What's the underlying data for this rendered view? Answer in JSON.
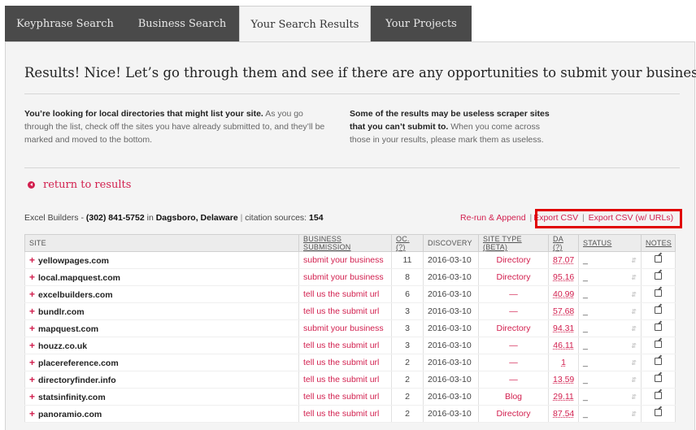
{
  "tabs": [
    {
      "label": "Keyphrase Search"
    },
    {
      "label": "Business Search"
    },
    {
      "label": "Your Search Results"
    },
    {
      "label": "Your Projects"
    }
  ],
  "headline": "Results! Nice! Let’s go through them and see if there are any opportunities to submit your business.",
  "intro_left": {
    "bold": "You’re looking for local directories that might list your site.",
    "text": " As you go through the list, check off the sites you have already submitted to, and they’ll be marked and moved to the bottom."
  },
  "intro_right": {
    "bold": "Some of the results may be useless scraper sites that you can’t submit to.",
    "text": " When you come across those in your results, please mark them as useless."
  },
  "return_label": "return to results",
  "business": {
    "name": "Excel Builders",
    "dash": " - ",
    "phone": "(302) 841-5752",
    "in": " in ",
    "location": "Dagsboro, Delaware",
    "sep": " | ",
    "citations_label": "citation sources: ",
    "citations": "154"
  },
  "actions": {
    "rerun": "Re-run & Append",
    "sep": "|",
    "export_csv": "Export CSV",
    "export_csv_urls": "Export CSV (w/ URLs)"
  },
  "table": {
    "headers": [
      "SITE",
      "BUSINESS SUBMISSION",
      "OC. (?)",
      "DISCOVERY",
      "SITE TYPE (BETA)",
      "DA (?)",
      "STATUS",
      "NOTES"
    ],
    "rows": [
      {
        "site": "yellowpages.com",
        "sub": "submit your business",
        "oc": "11",
        "disc": "2016-03-10",
        "type": "Directory",
        "da": "87.07",
        "status": "_"
      },
      {
        "site": "local.mapquest.com",
        "sub": "submit your business",
        "oc": "8",
        "disc": "2016-03-10",
        "type": "Directory",
        "da": "95.16",
        "status": "_"
      },
      {
        "site": "excelbuilders.com",
        "sub": "tell us the submit url",
        "oc": "6",
        "disc": "2016-03-10",
        "type": "—",
        "da": "40.99",
        "status": "_"
      },
      {
        "site": "bundlr.com",
        "sub": "tell us the submit url",
        "oc": "3",
        "disc": "2016-03-10",
        "type": "—",
        "da": "57.68",
        "status": "_"
      },
      {
        "site": "mapquest.com",
        "sub": "submit your business",
        "oc": "3",
        "disc": "2016-03-10",
        "type": "Directory",
        "da": "94.31",
        "status": "_"
      },
      {
        "site": "houzz.co.uk",
        "sub": "tell us the submit url",
        "oc": "3",
        "disc": "2016-03-10",
        "type": "—",
        "da": "46.11",
        "status": "_"
      },
      {
        "site": "placereference.com",
        "sub": "tell us the submit url",
        "oc": "2",
        "disc": "2016-03-10",
        "type": "—",
        "da": "1",
        "status": "_"
      },
      {
        "site": "directoryfinder.info",
        "sub": "tell us the submit url",
        "oc": "2",
        "disc": "2016-03-10",
        "type": "—",
        "da": "13.59",
        "status": "_"
      },
      {
        "site": "statsinfinity.com",
        "sub": "tell us the submit url",
        "oc": "2",
        "disc": "2016-03-10",
        "type": "Blog",
        "da": "29.11",
        "status": "_"
      },
      {
        "site": "panoramio.com",
        "sub": "tell us the submit url",
        "oc": "2",
        "disc": "2016-03-10",
        "type": "Directory",
        "da": "87.54",
        "status": "_"
      }
    ]
  },
  "colors": {
    "accent": "#d2204f",
    "tab_dark": "#4a4a4a",
    "highlight": "#e00000"
  }
}
